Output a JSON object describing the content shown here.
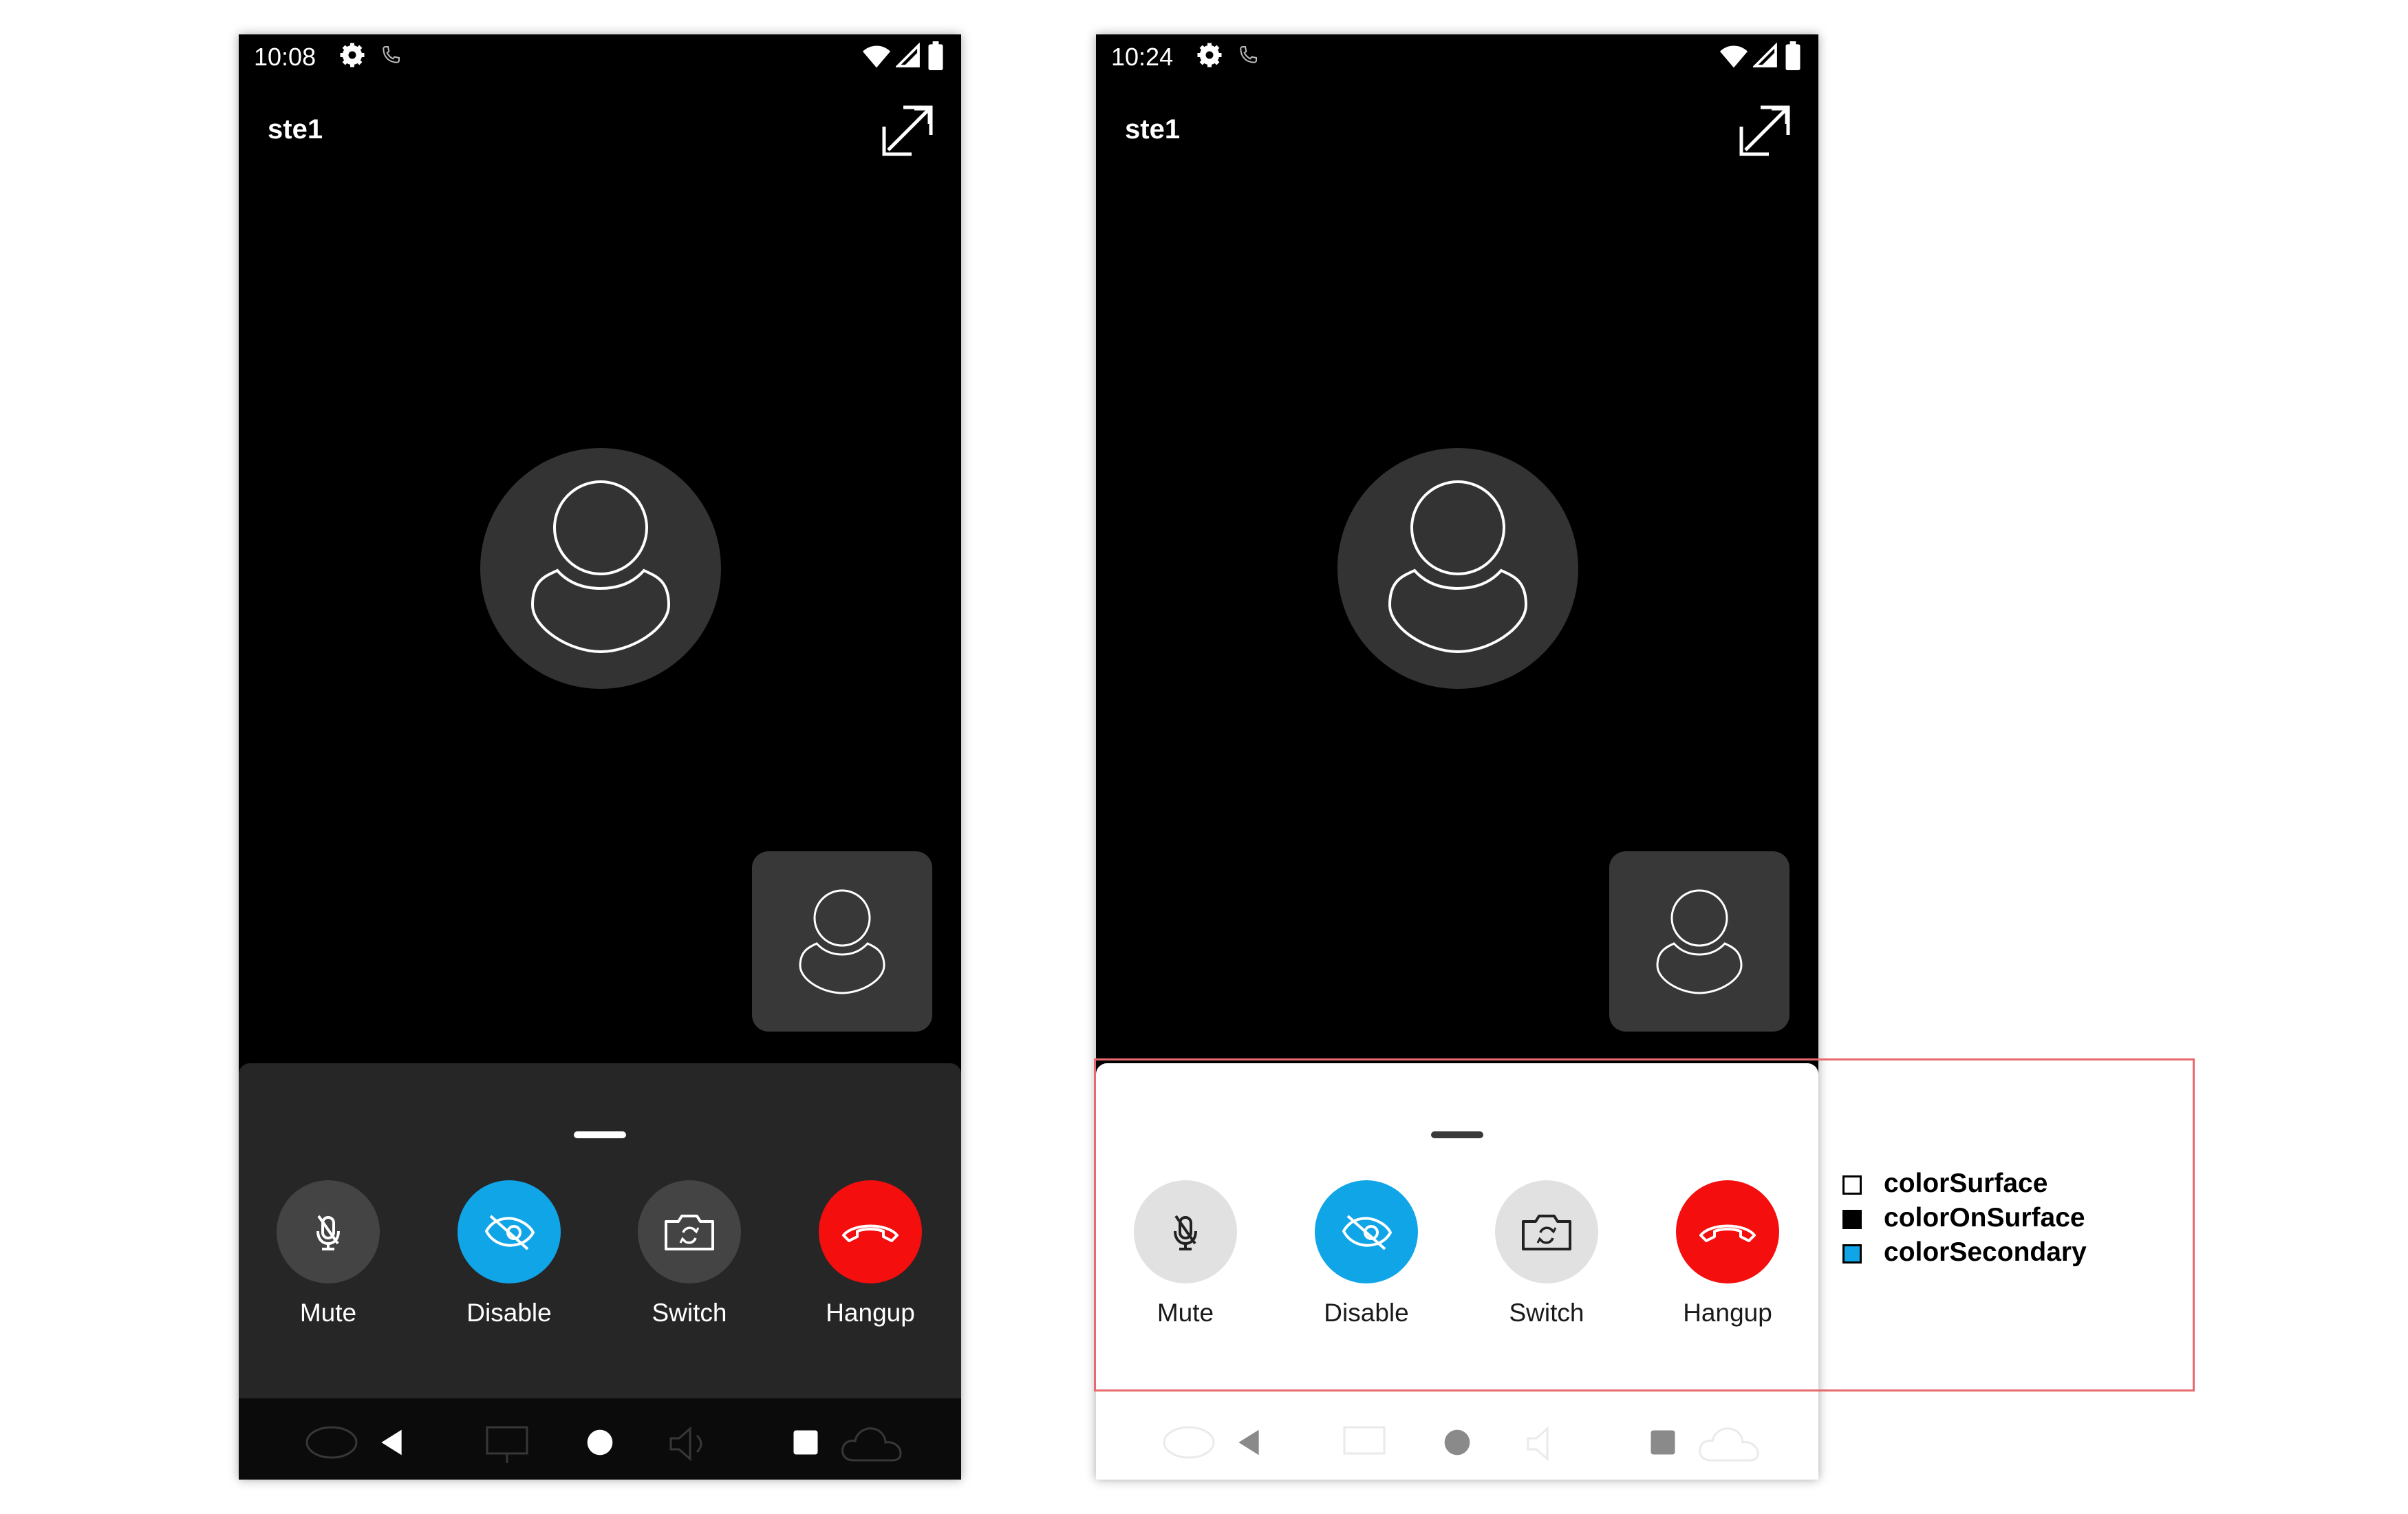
{
  "screens": [
    {
      "theme": "dark",
      "status_time": "10:08",
      "call_title": "ste1",
      "controls": [
        {
          "label": "Mute",
          "icon": "mic-off-icon"
        },
        {
          "label": "Disable",
          "icon": "video-off-icon"
        },
        {
          "label": "Switch",
          "icon": "camera-switch-icon"
        },
        {
          "label": "Hangup",
          "icon": "hangup-phone-icon"
        }
      ],
      "colors": {
        "surface": "#262626",
        "on_surface": "#ffffff",
        "secondary": "#10a5e6",
        "hangup": "#f40e0e"
      }
    },
    {
      "theme": "light",
      "status_time": "10:24",
      "call_title": "ste1",
      "controls": [
        {
          "label": "Mute",
          "icon": "mic-off-icon"
        },
        {
          "label": "Disable",
          "icon": "video-off-icon"
        },
        {
          "label": "Switch",
          "icon": "camera-switch-icon"
        },
        {
          "label": "Hangup",
          "icon": "hangup-phone-icon"
        }
      ],
      "colors": {
        "surface": "#ffffff",
        "on_surface": "#1a1a1a",
        "secondary": "#10a5e6",
        "hangup": "#f40e0e"
      }
    }
  ],
  "legend": [
    {
      "label": "colorSurface",
      "color": "#ffffff"
    },
    {
      "label": "colorOnSurface",
      "color": "#000000"
    },
    {
      "label": "colorSecondary",
      "color": "#10a5e6"
    }
  ],
  "highlight_color": "#e86a6f"
}
